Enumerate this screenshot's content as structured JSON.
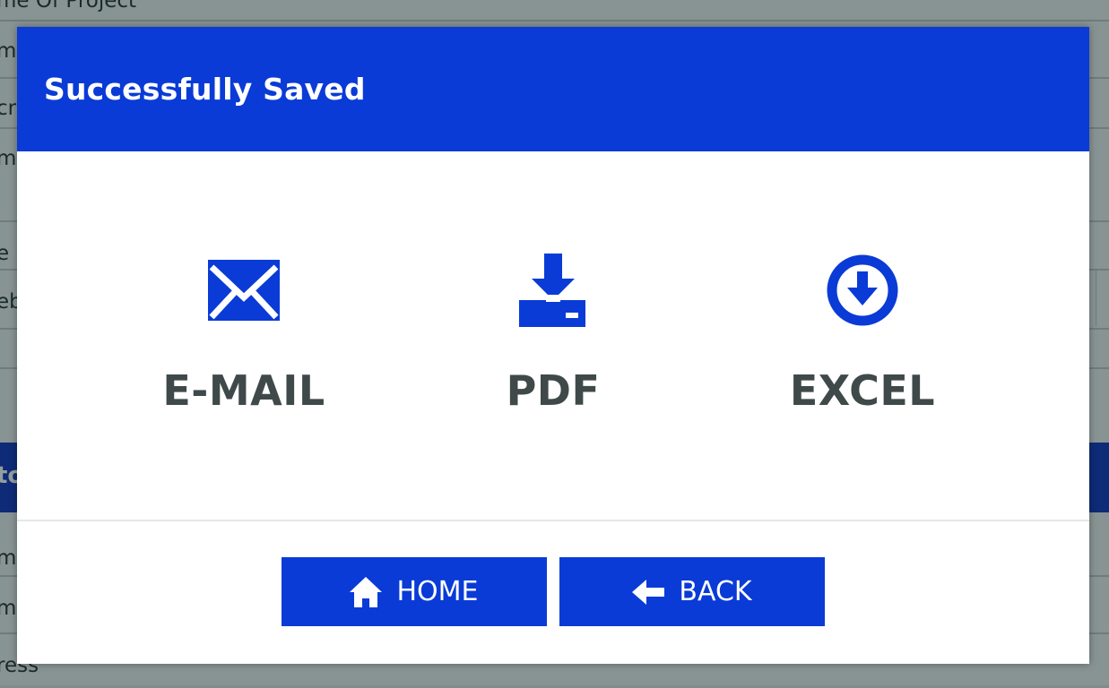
{
  "background": {
    "rows": [
      "me Of Project",
      "me",
      "cri",
      "mil",
      "e",
      "eb",
      "",
      "me",
      "me",
      "ress"
    ],
    "bar_label": "to"
  },
  "modal": {
    "title": "Successfully Saved",
    "options": [
      {
        "label": "E-MAIL",
        "icon": "mail-icon"
      },
      {
        "label": "PDF",
        "icon": "download-tray-icon"
      },
      {
        "label": "EXCEL",
        "icon": "circle-down-arrow-icon"
      }
    ],
    "buttons": {
      "home_label": "HOME",
      "back_label": "BACK"
    }
  },
  "colors": {
    "accent": "#0a3bd6",
    "label_text": "#3f4949",
    "overlay": "#7e8c8b"
  }
}
